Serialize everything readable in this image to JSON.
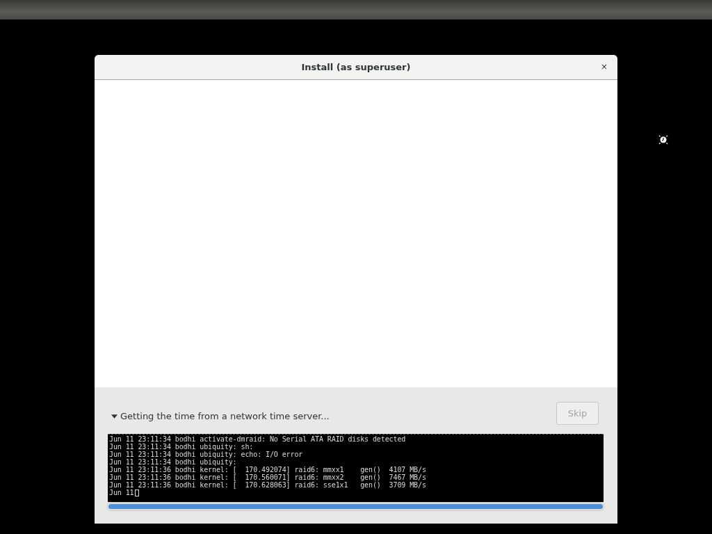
{
  "dialog": {
    "title": "Install (as superuser)",
    "close_label": "×"
  },
  "status": {
    "expanded": true,
    "text": "Getting the time from a network time server..."
  },
  "skip_button": {
    "label": "Skip",
    "disabled": true
  },
  "terminal": {
    "lines": [
      "Jun 11 23:11:34 bodhi activate-dmraid: No Serial ATA RAID disks detected",
      "Jun 11 23:11:34 bodhi ubiquity: sh:",
      "Jun 11 23:11:34 bodhi ubiquity: echo: I/O error",
      "Jun 11 23:11:34 bodhi ubiquity:",
      "Jun 11 23:11:36 bodhi kernel: [  170.492074] raid6: mmxx1    gen()  4107 MB/s",
      "Jun 11 23:11:36 bodhi kernel: [  170.560071] raid6: mmxx2    gen()  7467 MB/s",
      "Jun 11 23:11:36 bodhi kernel: [  170.628063] raid6: sse1x1   gen()  3709 MB/s",
      "Jun 11"
    ]
  },
  "progress": {
    "level": 1
  }
}
